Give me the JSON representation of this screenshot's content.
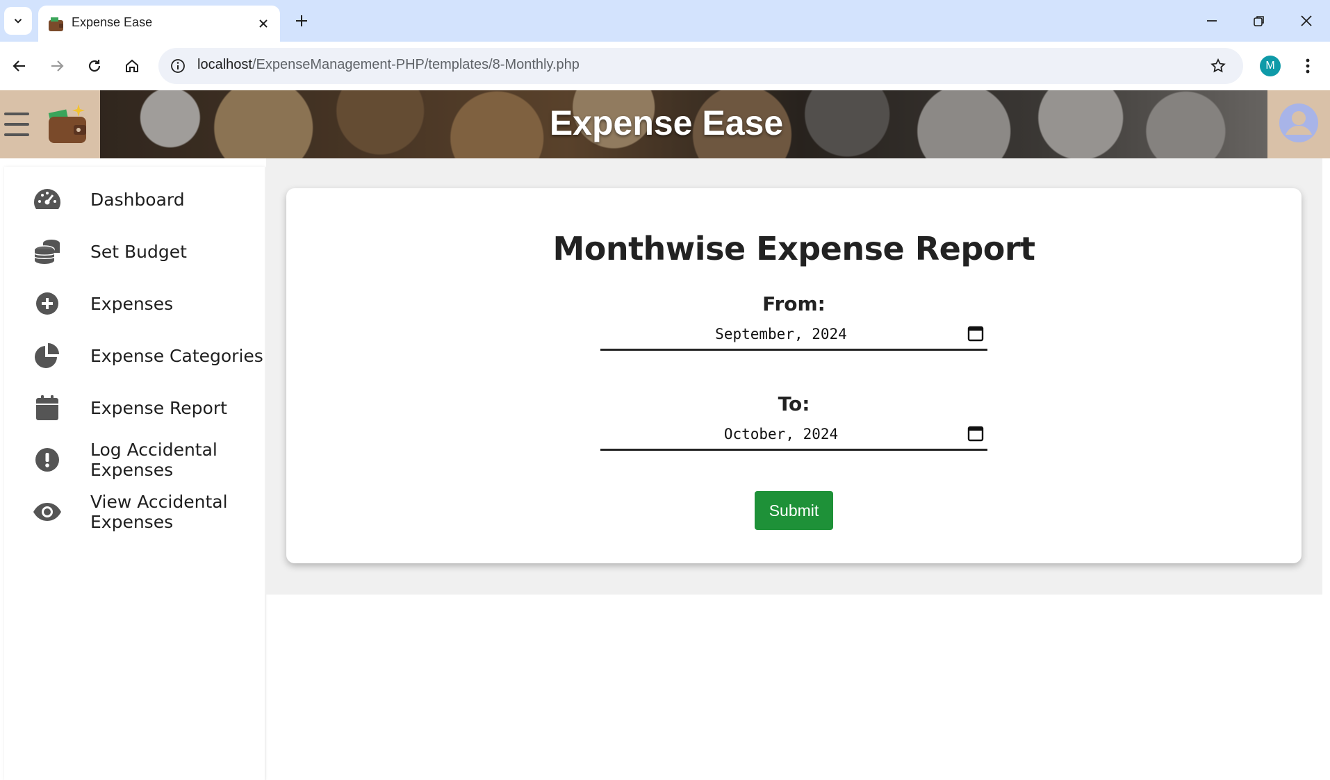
{
  "browser": {
    "tab_title": "Expense Ease",
    "url_host": "localhost",
    "url_path": "/ExpenseManagement-PHP/templates/8-Monthly.php",
    "profile_initial": "M"
  },
  "header": {
    "app_title": "Expense Ease"
  },
  "sidebar": {
    "items": [
      {
        "label": "Dashboard",
        "icon": "gauge-icon"
      },
      {
        "label": "Set Budget",
        "icon": "coins-icon"
      },
      {
        "label": "Expenses",
        "icon": "plus-circle-icon"
      },
      {
        "label": "Expense Categories",
        "icon": "pie-chart-icon"
      },
      {
        "label": "Expense Report",
        "icon": "calendar-icon"
      },
      {
        "label": "Log Accidental",
        "label2": "Expenses",
        "icon": "exclamation-icon"
      },
      {
        "label": "View Accidental",
        "label2": "Expenses",
        "icon": "eye-icon"
      }
    ]
  },
  "report": {
    "title": "Monthwise Expense Report",
    "from_label": "From:",
    "from_value": "September, 2024",
    "to_label": "To:",
    "to_value": "October, 2024",
    "submit_label": "Submit"
  },
  "colors": {
    "tab_bar": "#d3e3fd",
    "submit_green": "#1e9138",
    "profile_teal": "#0f9aa8",
    "user_avatar": "#a8b4e8"
  }
}
